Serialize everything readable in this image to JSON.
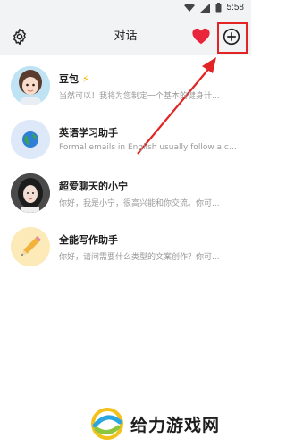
{
  "status_bar": {
    "time": "5:58"
  },
  "header": {
    "title": "对话"
  },
  "chats": [
    {
      "name": "豆包",
      "badge": "⚡",
      "preview": "当然可以！我将为您制定一个基本的健身计..."
    },
    {
      "name": "英语学习助手",
      "preview": "Formal emails in English usually follow a ce..."
    },
    {
      "name": "超爱聊天的小宁",
      "preview": "你好，我是小宁，很高兴能和你交流。你可..."
    },
    {
      "name": "全能写作助手",
      "preview": "你好，请问需要什么类型的文案创作？你可..."
    }
  ],
  "watermark": {
    "text": "给力游戏网"
  },
  "colors": {
    "accent_red": "#e22424",
    "header_bg": "#f2f3f5",
    "preview_gray": "#9a9a9a"
  },
  "icons": {
    "settings": "gear-icon",
    "favorite": "heart-icon",
    "new_chat": "plus-circle-icon"
  }
}
